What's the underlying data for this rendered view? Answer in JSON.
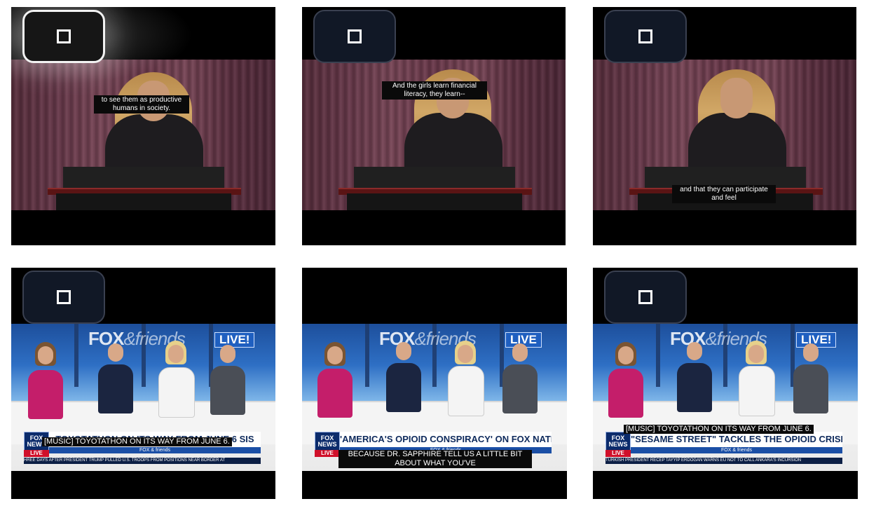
{
  "frames": [
    {
      "caption": "to see them as productive humans in society.",
      "stop_active": true
    },
    {
      "caption": "And the girls learn financial literacy, they learn--",
      "stop_active": false
    },
    {
      "caption": "and that they can participate and feel",
      "stop_active": false
    },
    {
      "show_logo": "FOX",
      "show_logo_amp": "&friends",
      "live_label": "LIVE!",
      "headline": "TOYOTATHON ON ITS WAY FROM JUNE 6 SIS",
      "cc": "[MUSIC] TOYOTATHON ON ITS WAY FROM JUNE 6.",
      "ticker": "HREE DAYS AFTER PRESIDENT TRUMP PULLED U.S. TROOPS FROM POSITIONS NEAR BORDER AT"
    },
    {
      "show_logo": "FOX",
      "show_logo_amp": "&friends",
      "live_label": "LIVE",
      "headline": "'AMERICA'S OPIOID CONSPIRACY' ON FOX NATION",
      "cc": "BECAUSE  DR. SAPPHIRE TELL US A LITTLE BIT ABOUT WHAT YOU'VE"
    },
    {
      "show_logo": "FOX",
      "show_logo_amp": "&friends",
      "live_label": "LIVE!",
      "headline": "\"SESAME STREET\" TACKLES THE OPIOID CRISIS",
      "cc": "[MUSIC] TOYOTATHON ON ITS WAY FROM JUNE 6.",
      "ticker": "TURKISH PRESIDENT RECEP TAYYIP ERDOGAN WARNS EU NOT TO CALL ANKARA'S INCURSION"
    }
  ],
  "fox_news_label": "FOX NEWS",
  "fox_live_label": "LIVE",
  "showbar_label": "FOX & friends",
  "icons": {
    "stop": "stop-icon"
  }
}
